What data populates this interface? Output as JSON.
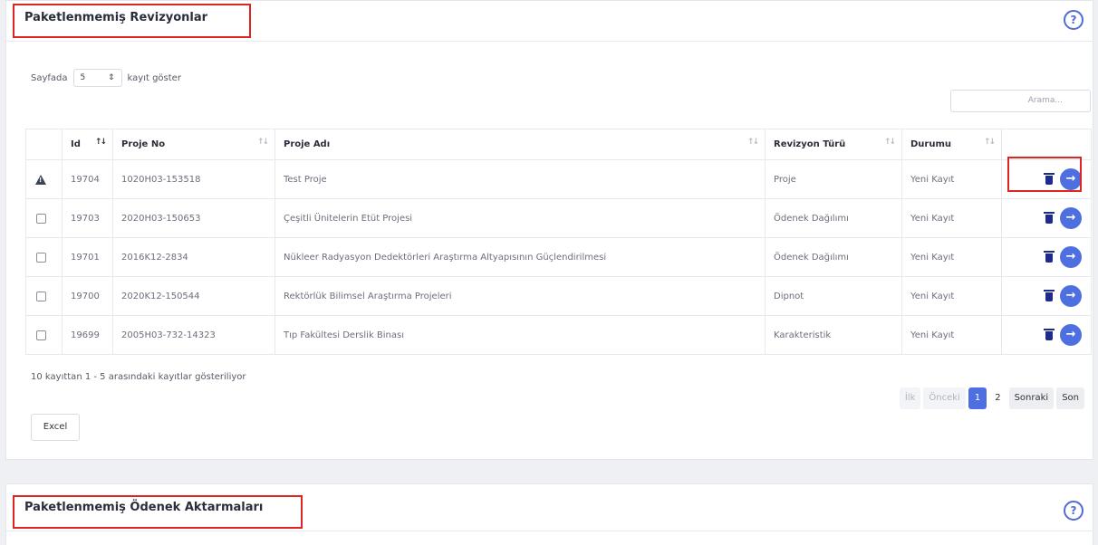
{
  "panel1": {
    "title": "Paketlenmemiş Revizyonlar",
    "help": "?",
    "length_prefix": "Sayfada",
    "length_value": "5",
    "length_suffix": "kayıt göster",
    "search_placeholder": "Arama...",
    "columns": [
      "Id",
      "Proje No",
      "Proje Adı",
      "Revizyon Türü",
      "Durumu"
    ],
    "rows": [
      {
        "id": "19704",
        "no": "1020H03-153518",
        "name": "Test Proje",
        "type": "Proje",
        "status": "Yeni Kayıt",
        "marker": "warning"
      },
      {
        "id": "19703",
        "no": "2020H03-150653",
        "name": "Çeşitli Ünitelerin Etüt Projesi",
        "type": "Ödenek Dağılımı",
        "status": "Yeni Kayıt",
        "marker": "checkbox"
      },
      {
        "id": "19701",
        "no": "2016K12-2834",
        "name": "Nükleer Radyasyon Dedektörleri Araştırma Altyapısının Güçlendirilmesi",
        "type": "Ödenek Dağılımı",
        "status": "Yeni Kayıt",
        "marker": "checkbox"
      },
      {
        "id": "19700",
        "no": "2020K12-150544",
        "name": "Rektörlük Bilimsel Araştırma Projeleri",
        "type": "Dipnot",
        "status": "Yeni Kayıt",
        "marker": "checkbox"
      },
      {
        "id": "19699",
        "no": "2005H03-732-14323",
        "name": "Tıp Fakültesi Derslik Binası",
        "type": "Karakteristik",
        "status": "Yeni Kayıt",
        "marker": "checkbox"
      }
    ],
    "info": "10 kayıttan 1 - 5 arasındaki kayıtlar gösteriliyor",
    "pager": {
      "first": "İlk",
      "prev": "Önceki",
      "page1": "1",
      "page2": "2",
      "next": "Sonraki",
      "last": "Son"
    },
    "excel": "Excel"
  },
  "panel2": {
    "title": "Paketlenmemiş Ödenek Aktarmaları",
    "help": "?"
  },
  "colors": {
    "accent": "#4e6fe0",
    "highlight": "#e02424",
    "trash": "#1c2b8c"
  },
  "icons": {
    "help": "question-circle-icon",
    "sort": "sort-arrows-icon",
    "warning": "warning-triangle-icon",
    "trash": "trash-icon",
    "go": "arrow-right-circle-icon",
    "select": "chevron-updown-icon"
  }
}
